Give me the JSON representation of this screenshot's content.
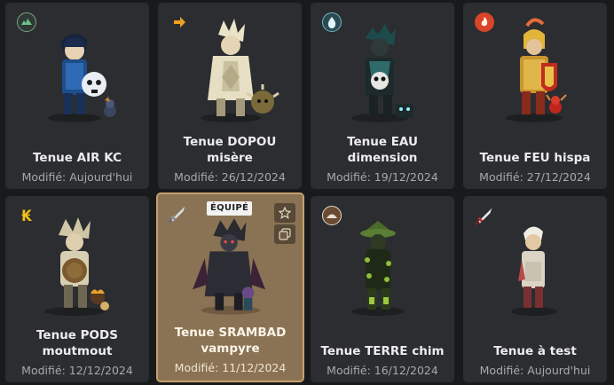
{
  "outfits": [
    {
      "name": "Tenue AIR KC",
      "modified": "Modifié: Aujourd'hui",
      "element_icon": "air-icon"
    },
    {
      "name": "Tenue DOPOU misère",
      "modified": "Modifié: 26/12/2024",
      "element_icon": "agility-arrow-icon"
    },
    {
      "name": "Tenue EAU dimension",
      "modified": "Modifié: 19/12/2024",
      "element_icon": "water-icon"
    },
    {
      "name": "Tenue FEU hispa",
      "modified": "Modifié: 27/12/2024",
      "element_icon": "fire-icon"
    },
    {
      "name": "Tenue PODS moutmout",
      "modified": "Modifié: 12/12/2024",
      "element_icon": "kamas-icon"
    },
    {
      "name": "Tenue SRAMBAD vampyre",
      "modified": "Modifié: 11/12/2024",
      "element_icon": "sword-icon",
      "badge": "ÉQUIPÉ"
    },
    {
      "name": "Tenue TERRE chim",
      "modified": "Modifié: 16/12/2024",
      "element_icon": "earth-icon"
    },
    {
      "name": "Tenue à test",
      "modified": "Modifié: Aujourd'hui",
      "element_icon": "sword-icon"
    }
  ],
  "colors": {
    "card_bg": "#2b2d30",
    "equipped_bg": "#8a7354",
    "equipped_border": "#c4a06c",
    "air": "#4e8a5c",
    "water": "#3b8c9a",
    "fire": "#d8452a",
    "earth": "#7a5a3e",
    "agility": "#f0a020",
    "kamas": "#f3c21a"
  }
}
